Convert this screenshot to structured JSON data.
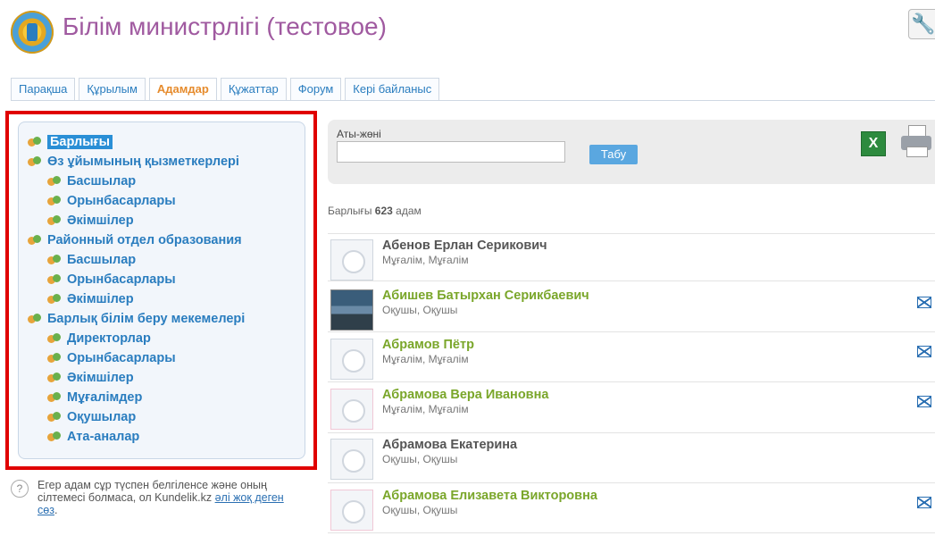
{
  "header": {
    "title": "Білім министрлігі (тестовое)"
  },
  "tabs": [
    {
      "label": "Парақша"
    },
    {
      "label": "Құрылым"
    },
    {
      "label": "Адамдар",
      "active": true
    },
    {
      "label": "Құжаттар"
    },
    {
      "label": "Форум"
    },
    {
      "label": "Кері байланыс"
    }
  ],
  "tree": [
    {
      "label": "Барлығы",
      "selected": true
    },
    {
      "label": "Өз ұйымының қызметкерлері"
    },
    {
      "label": "Басшылар"
    },
    {
      "label": "Орынбасарлары"
    },
    {
      "label": "Әкімшілер"
    },
    {
      "label": "Районный отдел образования"
    },
    {
      "label": "Басшылар"
    },
    {
      "label": "Орынбасарлары"
    },
    {
      "label": "Әкімшілер"
    },
    {
      "label": "Барлық білім беру мекемелері"
    },
    {
      "label": "Директорлар"
    },
    {
      "label": "Орынбасарлары"
    },
    {
      "label": "Әкімшілер"
    },
    {
      "label": "Мұғалімдер"
    },
    {
      "label": "Оқушылар"
    },
    {
      "label": "Ата-аналар"
    }
  ],
  "help": {
    "text": "Егер адам сұр түспен белгіленсе және оның сілтемесі болмаса, ол Kundelik.kz ",
    "link": "әлі жоқ деген сөз",
    "end": "."
  },
  "search": {
    "label": "Аты-жөні",
    "value": "",
    "button": "Табу"
  },
  "count": {
    "prefix": "Барлығы ",
    "number": "623",
    "suffix": " адам"
  },
  "people": [
    {
      "name": "Абенов Ерлан Серикович",
      "role": "Мұғалім, Мұғалім",
      "active": false,
      "avatar": "default",
      "mail": false
    },
    {
      "name": "Абишев Батырхан Серикбаевич",
      "role": "Оқушы, Оқушы",
      "active": true,
      "avatar": "photo",
      "mail": true
    },
    {
      "name": "Абрамов Пётр",
      "role": "Мұғалім, Мұғалім",
      "active": true,
      "avatar": "default",
      "mail": true
    },
    {
      "name": "Абрамова Вера Ивановна",
      "role": "Мұғалім, Мұғалім",
      "active": true,
      "avatar": "pink",
      "mail": true
    },
    {
      "name": "Абрамова Екатерина",
      "role": "Оқушы, Оқушы",
      "active": false,
      "avatar": "default",
      "mail": false
    },
    {
      "name": "Абрамова Елизавета Викторовна",
      "role": "Оқушы, Оқушы",
      "active": true,
      "avatar": "pink",
      "mail": true
    }
  ]
}
